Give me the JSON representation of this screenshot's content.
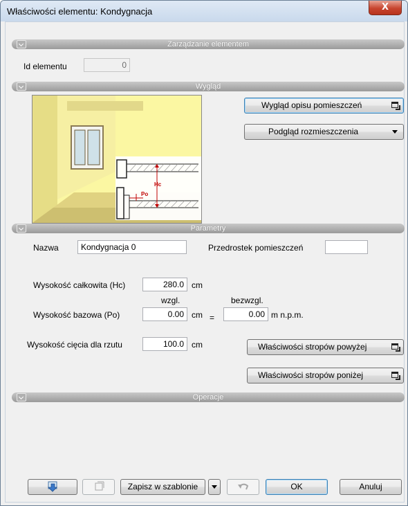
{
  "window": {
    "title": "Właściwości elementu: Kondygnacja",
    "close_label": "X"
  },
  "sections": {
    "management": "Zarządzanie elementem",
    "appearance": "Wygląd",
    "parameters": "Parametry",
    "operations": "Operacje"
  },
  "management": {
    "id_label": "Id elementu",
    "id_value": "0"
  },
  "appearance": {
    "room_desc_button": "Wygląd opisu pomieszczeń",
    "layout_preview_button": "Podgląd rozmieszczenia",
    "diagram_labels": {
      "hc": "Hc",
      "po": "Po"
    }
  },
  "parameters": {
    "name_label": "Nazwa",
    "name_value": "Kondygnacja 0",
    "room_prefix_label": "Przedrostek pomieszczeń",
    "room_prefix_value": "",
    "total_height_label": "Wysokość całkowita (Hc)",
    "total_height_value": "280.0",
    "unit_cm": "cm",
    "relative_label": "wzgl.",
    "absolute_label": "bezwzgl.",
    "base_height_label": "Wysokość bazowa (Po)",
    "base_height_rel_value": "0.00",
    "equals": "=",
    "base_height_abs_value": "0.00",
    "unit_mnpm": "m n.p.m.",
    "cut_height_label": "Wysokość cięcia dla rzutu",
    "cut_height_value": "100.0",
    "slabs_above_button": "Właściwości stropów powyżej",
    "slabs_below_button": "Właściwości stropów poniżej"
  },
  "footer": {
    "save_template_button": "Zapisz w szablonie",
    "ok_button": "OK",
    "cancel_button": "Anuluj"
  },
  "colors": {
    "accent": "#3c7fb1",
    "section_bar": "#9a9a9a",
    "close": "#c7452f",
    "dimension": "#c00000"
  }
}
